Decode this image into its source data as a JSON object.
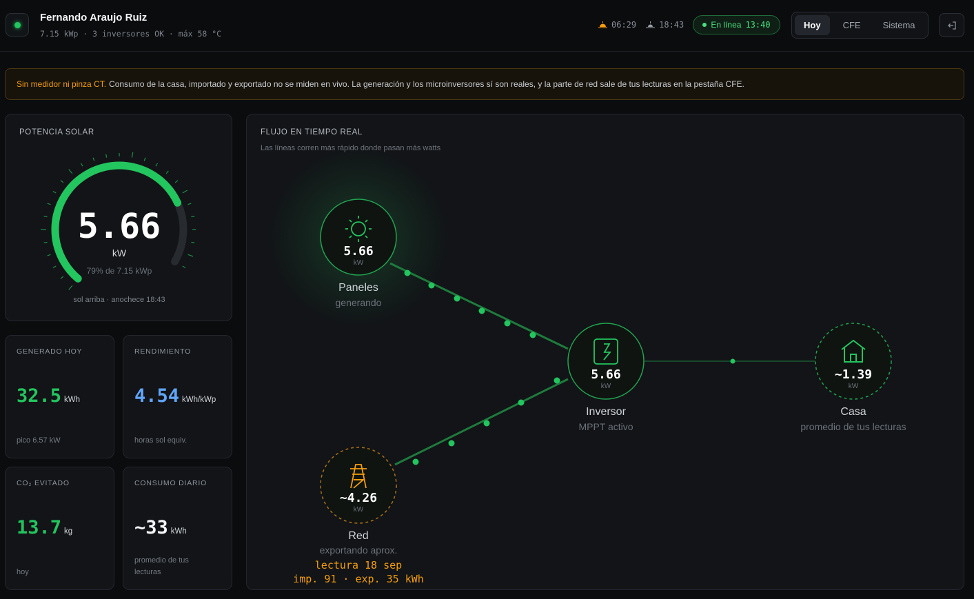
{
  "header": {
    "name": "Fernando Araujo Ruiz",
    "subtitle": "7.15 kWp · 3 inversores OK · máx 58 °C",
    "sunrise": "06:29",
    "sunset": "18:43",
    "online_label": "En línea",
    "online_time": "13:40",
    "tabs": [
      "Hoy",
      "CFE",
      "Sistema"
    ],
    "active_tab": "Hoy"
  },
  "banner": {
    "highlight": "Sin medidor ni pinza CT.",
    "text": "Consumo de la casa, importado y exportado no se miden en vivo. La generación y los microinversores sí son reales, y la parte de red sale de tus lecturas en la pestaña CFE."
  },
  "gauge": {
    "title": "POTENCIA SOLAR",
    "value": "5.66",
    "unit": "kW",
    "percent_text": "79% de 7.15 kWp",
    "fraction": 0.79,
    "footer": "sol arriba · anochece 18:43"
  },
  "stats": [
    {
      "label": "GENERADO HOY",
      "value": "32.5",
      "unit": "kWh",
      "foot": "pico 6.57 kW"
    },
    {
      "label": "RENDIMIENTO",
      "value": "4.54",
      "unit": "kWh/kWp",
      "foot": "horas sol equiv."
    },
    {
      "label": "CO₂ EVITADO",
      "value": "13.7",
      "unit": "kg",
      "foot": "hoy"
    },
    {
      "label": "CONSUMO DIARIO",
      "value": "~33",
      "unit": "kWh",
      "foot": "promedio de tus lecturas"
    }
  ],
  "flow": {
    "title": "FLUJO EN TIEMPO REAL",
    "subtitle": "Las líneas corren más rápido donde pasan más watts",
    "panels": {
      "value": "5.66",
      "unit": "kW",
      "label": "Paneles",
      "sub": "generando"
    },
    "inverter": {
      "value": "5.66",
      "unit": "kW",
      "label": "Inversor",
      "sub": "MPPT activo"
    },
    "house": {
      "value": "~1.39",
      "unit": "kW",
      "label": "Casa",
      "sub": "promedio de tus lecturas"
    },
    "grid": {
      "value": "~4.26",
      "unit": "kW",
      "label": "Red",
      "sub": "exportando aprox.",
      "reading": "lectura 18 sep",
      "imp_exp": "imp. 91 · exp. 35 kWh"
    }
  },
  "colors": {
    "accent": "#22c55e",
    "warning": "#f59e0b",
    "blue": "#60a5fa"
  }
}
